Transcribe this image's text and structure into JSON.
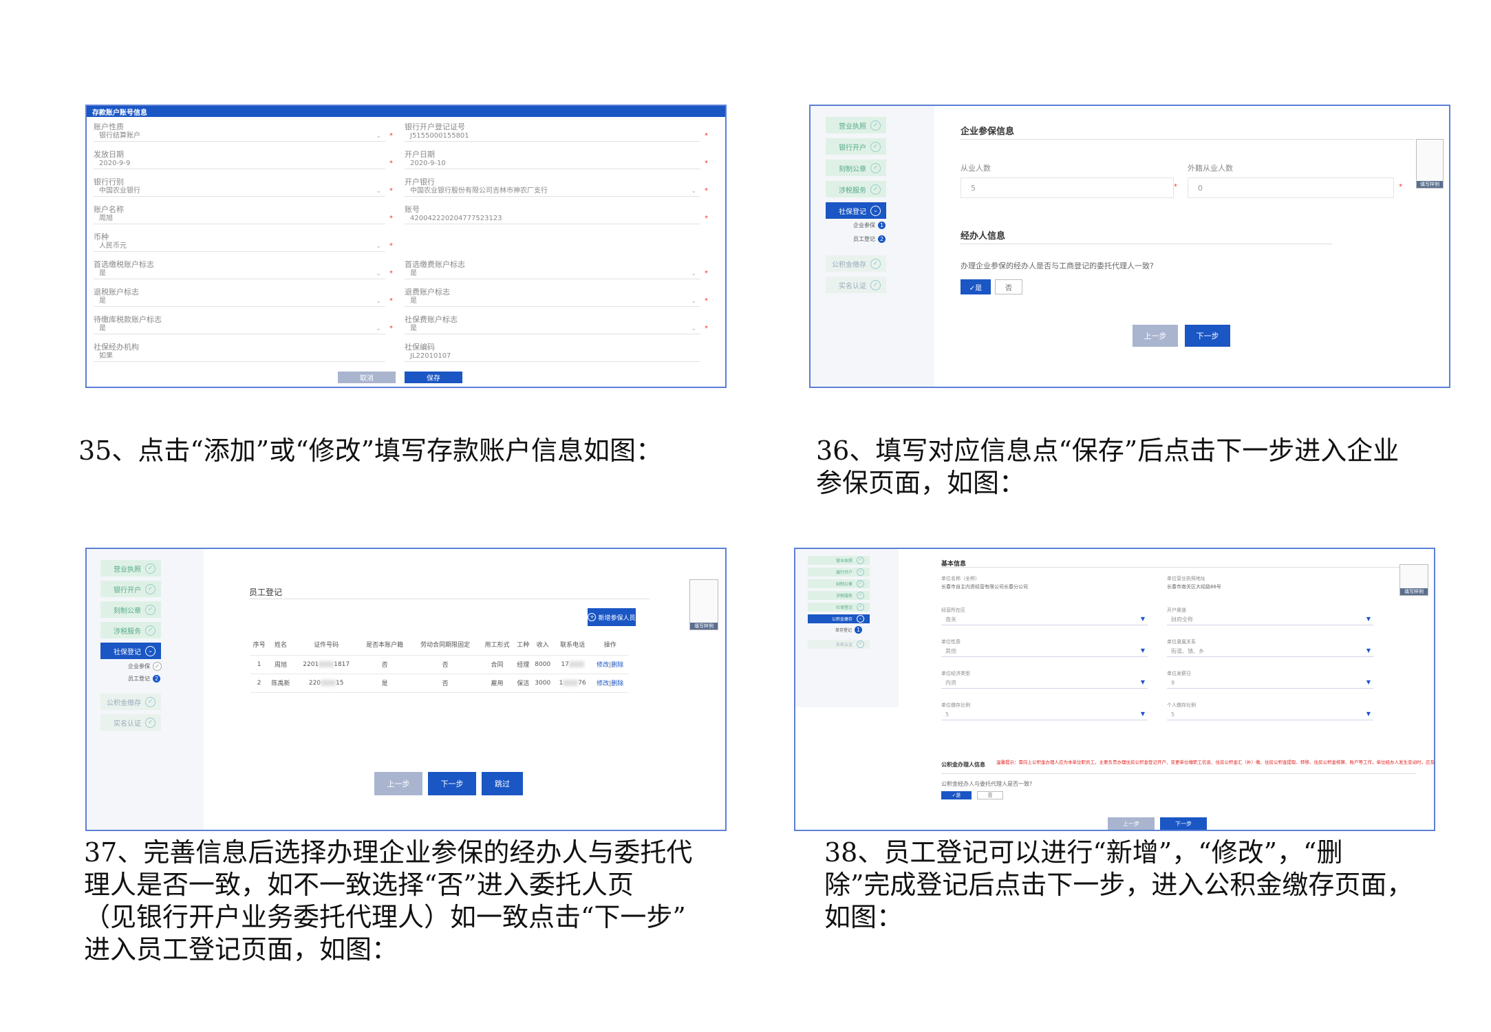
{
  "shot1": {
    "header": "存款账户账号信息",
    "fields": [
      {
        "label": "账户性质",
        "value": "银行结算账户",
        "dropdown": true,
        "req": true
      },
      {
        "label": "银行开户登记证号",
        "value": "J5155000155801",
        "dropdown": false,
        "req": true
      },
      {
        "label": "发放日期",
        "value": "2020-9-9",
        "dropdown": false,
        "req": true
      },
      {
        "label": "开户日期",
        "value": "2020-9-10",
        "dropdown": false,
        "req": true
      },
      {
        "label": "银行行别",
        "value": "中国农业银行",
        "dropdown": true,
        "req": true
      },
      {
        "label": "开户银行",
        "value": "中国农业银行股份有限公司吉林市神农厂支行",
        "dropdown": true,
        "req": true
      },
      {
        "label": "账户名称",
        "value": "周旭",
        "dropdown": false,
        "req": true
      },
      {
        "label": "账号",
        "value": "42004222020477752312​3",
        "dropdown": false,
        "req": true
      },
      {
        "label": "币种",
        "value": "人民币元",
        "dropdown": true,
        "req": true
      },
      {
        "label": "",
        "value": "",
        "dropdown": false,
        "req": false
      },
      {
        "label": "首选缴税账户标志",
        "value": "是",
        "dropdown": true,
        "req": true
      },
      {
        "label": "首选缴费账户标志",
        "value": "是",
        "dropdown": true,
        "req": true
      },
      {
        "label": "退税账户标志",
        "value": "是",
        "dropdown": true,
        "req": true
      },
      {
        "label": "退费账户标志",
        "value": "是",
        "dropdown": true,
        "req": true
      },
      {
        "label": "待缴库税款账户标志",
        "value": "是",
        "dropdown": true,
        "req": true
      },
      {
        "label": "社保费账户标志",
        "value": "是",
        "dropdown": true,
        "req": true
      },
      {
        "label": "社保经办机构",
        "value": "如果",
        "dropdown": false,
        "req": false
      },
      {
        "label": "社保编码",
        "value": "JL22010107",
        "dropdown": false,
        "req": false
      }
    ],
    "cancel": "取消",
    "save": "保存"
  },
  "shot2": {
    "sidebar": [
      "营业执照",
      "银行开户",
      "刻制公章",
      "涉税服务",
      "社保登记",
      "公积金缴存",
      "实名认证"
    ],
    "sub": [
      {
        "label": "企业参保",
        "num": "1"
      },
      {
        "label": "员工登记",
        "num": "2"
      }
    ],
    "section1": "企业参保信息",
    "f1_label": "从业人数",
    "f1_value": "5",
    "f2_label": "外籍从业人数",
    "f2_value": "0",
    "section2": "经办人信息",
    "question": "办理企业参保的经办人是否与工商登记的委托代理人一致?",
    "yes": "✓是",
    "no": "否",
    "prev": "上一步",
    "next": "下一步",
    "thumb": "填写样例"
  },
  "shot3": {
    "sidebar": [
      "营业执照",
      "银行开户",
      "刻制公章",
      "涉税服务",
      "社保登记",
      "公积金缴存",
      "实名认证"
    ],
    "sub": [
      {
        "label": "企业参保"
      },
      {
        "label": "员工登记",
        "num": "2"
      }
    ],
    "title": "员工登记",
    "add_button": "新增参保人员",
    "columns": [
      "序号",
      "姓名",
      "证件号码",
      "是否本账户籍",
      "劳动合同期限固定",
      "用工形式",
      "工种",
      "收入",
      "联系电话",
      "操作"
    ],
    "rows": [
      [
        "1",
        "周旭",
        "2201",
        "1817",
        "否",
        "否",
        "合同",
        "经理",
        "8000",
        "17"
      ],
      [
        "2",
        "陈禹新",
        "220",
        "15",
        "是",
        "否",
        "雇用",
        "保洁",
        "3000",
        "1",
        "76"
      ]
    ],
    "op_edit": "修改",
    "op_sep": "|",
    "op_del": "删除",
    "prev": "上一步",
    "next": "下一步",
    "skip": "跳过",
    "thumb": "填写样例"
  },
  "shot4": {
    "sidebar": [
      "营业执照",
      "银行开户",
      "刻制公章",
      "涉税服务",
      "社保登记",
      "公积金缴存",
      "实名认证"
    ],
    "sub": [
      {
        "label": "单存登记",
        "num": "1"
      }
    ],
    "section": "基本信息",
    "fields": [
      {
        "label": "单位名称（全称）",
        "value": "长春市自主内资经营有限公司长春分公司",
        "dd": false
      },
      {
        "label": "单位营业执照地址",
        "value": "长春市南关区大经路88号",
        "dd": false
      },
      {
        "label": "经营所在区",
        "value": "南关",
        "dd": true
      },
      {
        "label": "开户渠道",
        "value": "财府全称",
        "dd": true
      },
      {
        "label": "单位性质",
        "value": "其他",
        "dd": true
      },
      {
        "label": "单位隶属关系",
        "value": "街道、镇、乡",
        "dd": true
      },
      {
        "label": "单位经济类型",
        "value": "内资",
        "dd": true
      },
      {
        "label": "单位发薪日",
        "value": "9",
        "dd": true
      },
      {
        "label": "单位缴存比例",
        "value": "5",
        "dd": true
      },
      {
        "label": "个人缴存比例",
        "value": "5",
        "dd": true
      }
    ],
    "agent_title": "公积金办理人信息",
    "warning": "温馨提示：需向上公积金办理人应为本单位职员工，主要负责办理住房公积金登记开户、变更单位缴职工信息、住房公积金汇（补）缴、住房公积金提取、转移、住房公积金核算、账户等工作，单位经办人发生变动时，应及时办理变更手续。",
    "question": "公积金经办人与委托代理人是否一致?",
    "yes": "✓是",
    "no": "否",
    "prev": "上一步",
    "next": "下一步",
    "thumb": "填写样例"
  },
  "captions": {
    "c35": "35、点击“添加”或“修改”填写存款账户信息如图：",
    "c36a": "36、填写对应信息点“保存”后点击下一步进入企业",
    "c36b": "参保页面，如图：",
    "c37a": "37、完善信息后选择办理企业参保的经办人与委托代",
    "c37b": "理人是否一致，如不一致选择“否”进入委托人页",
    "c37c": "（见银行开户业务委托代理人）如一致点击“下一步”",
    "c37d": "进入员工登记页面，如图：",
    "c38a": "38、员工登记可以进行“新增”，“修改”，“删",
    "c38b": "除”完成登记后点击下一步，进入公积金缴存页面，",
    "c38c": "如图："
  }
}
